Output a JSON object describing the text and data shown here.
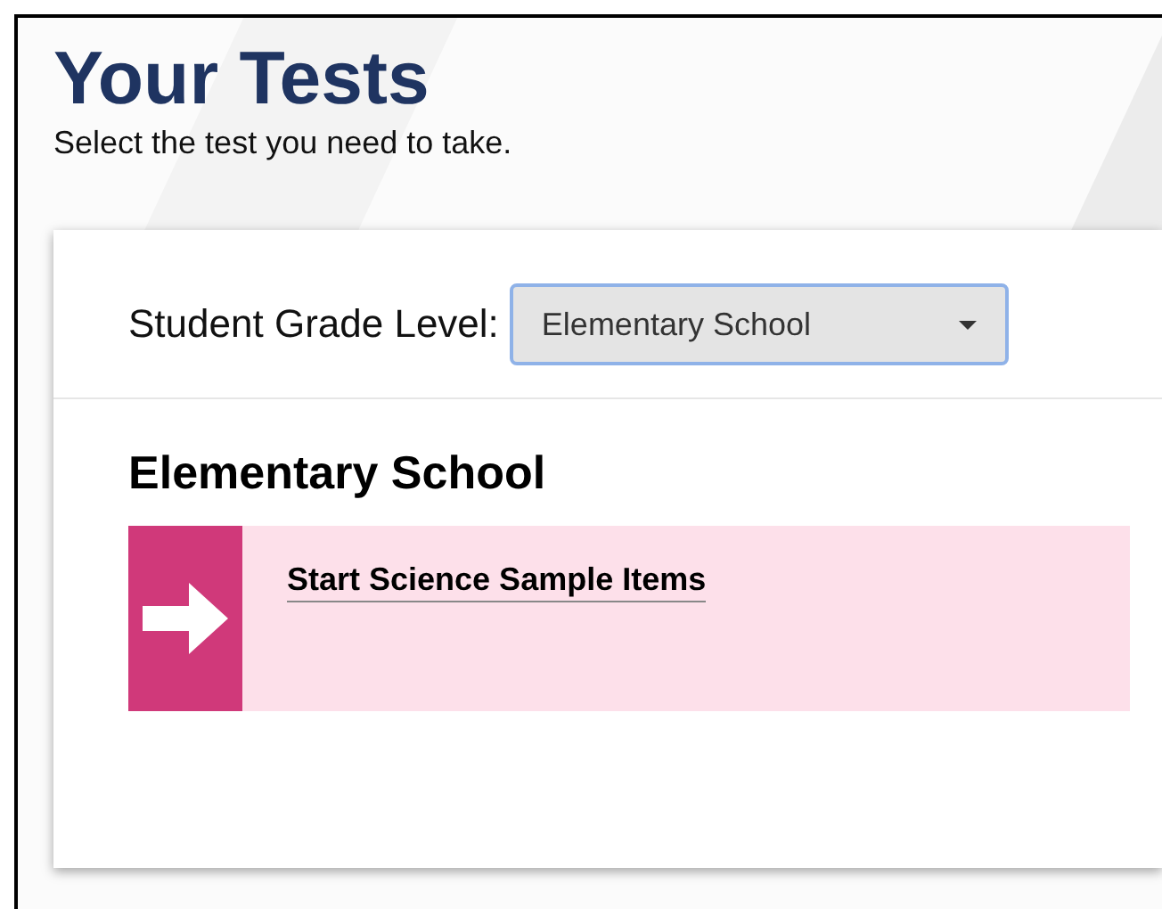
{
  "header": {
    "title": "Your Tests",
    "subtitle": "Select the test you need to take."
  },
  "grade_select": {
    "label": "Student Grade Level:",
    "value": "Elementary School"
  },
  "section": {
    "heading": "Elementary School",
    "tests": [
      {
        "label": "Start Science Sample Items"
      }
    ]
  }
}
